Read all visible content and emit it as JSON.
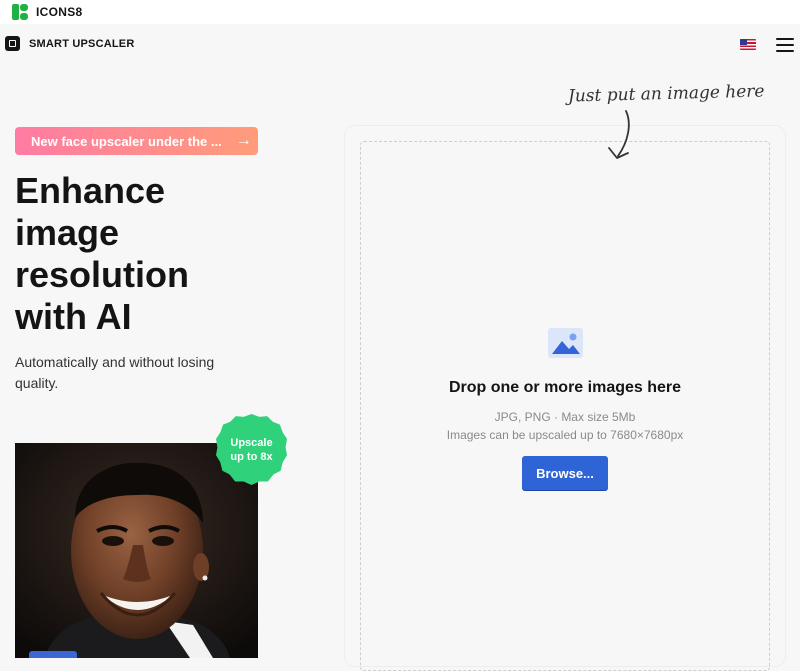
{
  "topbar": {
    "brand_name": "ICONS8",
    "logo_icon": "icons8-logo-icon"
  },
  "subnav": {
    "app_name": "SMART UPSCALER",
    "app_icon": "upscaler-logo-icon",
    "language_icon": "us-flag-icon",
    "menu_icon": "hamburger-menu-icon"
  },
  "hero": {
    "promo_label": "New face upscaler under the ...",
    "promo_arrow": "→",
    "title_lines": [
      "Enhance",
      "image",
      "resolution",
      "with AI"
    ],
    "subtitle": "Automatically and without losing quality.",
    "badge_label": "Upscale up to 8x"
  },
  "dropzone": {
    "hint": "Just put an image here",
    "title": "Drop one or more images here",
    "formats": "JPG, PNG · Max size 5Mb",
    "limit": "Images can be upscaled up to 7680×7680px",
    "browse_label": "Browse...",
    "image_icon": "image-placeholder-icon"
  },
  "colors": {
    "brand_green": "#1fb141",
    "promo_gradient_start": "#ff7ba3",
    "promo_gradient_end": "#ff9c7a",
    "badge_green": "#2fd27b",
    "primary_blue": "#2f64d6"
  }
}
